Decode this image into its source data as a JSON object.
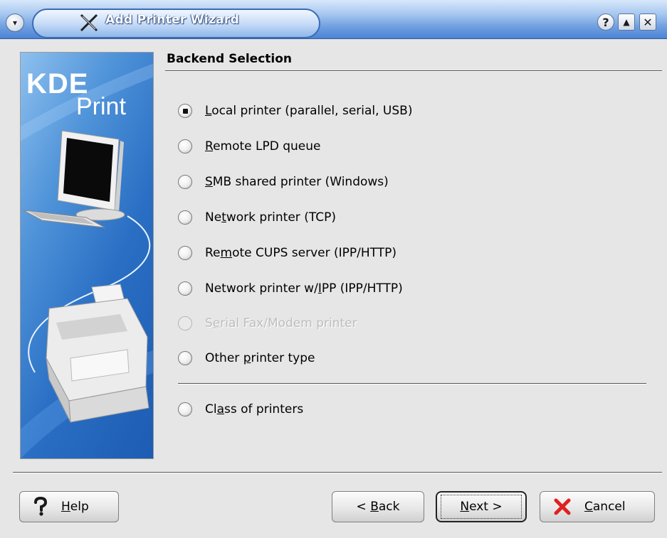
{
  "window": {
    "title": "Add Printer Wizard",
    "help_glyph": "?",
    "max_glyph": "▲",
    "close_glyph": "✕",
    "menu_glyph": "▾"
  },
  "banner": {
    "logo_top": "KDE",
    "logo_bottom": "Print"
  },
  "section": {
    "title": "Backend Selection"
  },
  "options": [
    {
      "label": "Local printer (parallel, serial, USB)",
      "accel_index": 0,
      "checked": true,
      "enabled": true
    },
    {
      "label": "Remote LPD queue",
      "accel_index": 0,
      "checked": false,
      "enabled": true
    },
    {
      "label": "SMB shared printer (Windows)",
      "accel_index": 0,
      "checked": false,
      "enabled": true
    },
    {
      "label": "Network printer (TCP)",
      "accel_index": 2,
      "checked": false,
      "enabled": true
    },
    {
      "label": "Remote CUPS server (IPP/HTTP)",
      "accel_index": 2,
      "checked": false,
      "enabled": true
    },
    {
      "label": "Network printer w/IPP (IPP/HTTP)",
      "accel_index": 18,
      "checked": false,
      "enabled": true
    },
    {
      "label": "Serial Fax/Modem printer",
      "accel_index": 1,
      "checked": false,
      "enabled": false
    },
    {
      "label": "Other printer type",
      "accel_index": 6,
      "checked": false,
      "enabled": true
    }
  ],
  "class_option": {
    "label": "Class of printers",
    "accel_index": 2,
    "checked": false,
    "enabled": true
  },
  "buttons": {
    "help": "Help",
    "back": "< Back",
    "next": "Next >",
    "cancel": "Cancel"
  },
  "colors": {
    "titlebar_accent": "#4b83d4",
    "banner_blue": "#2a6fc4",
    "cancel_red": "#e02020"
  },
  "icons": {
    "app": "printer-wizard-icon",
    "help": "question-mark-icon",
    "cancel": "red-x-icon"
  }
}
